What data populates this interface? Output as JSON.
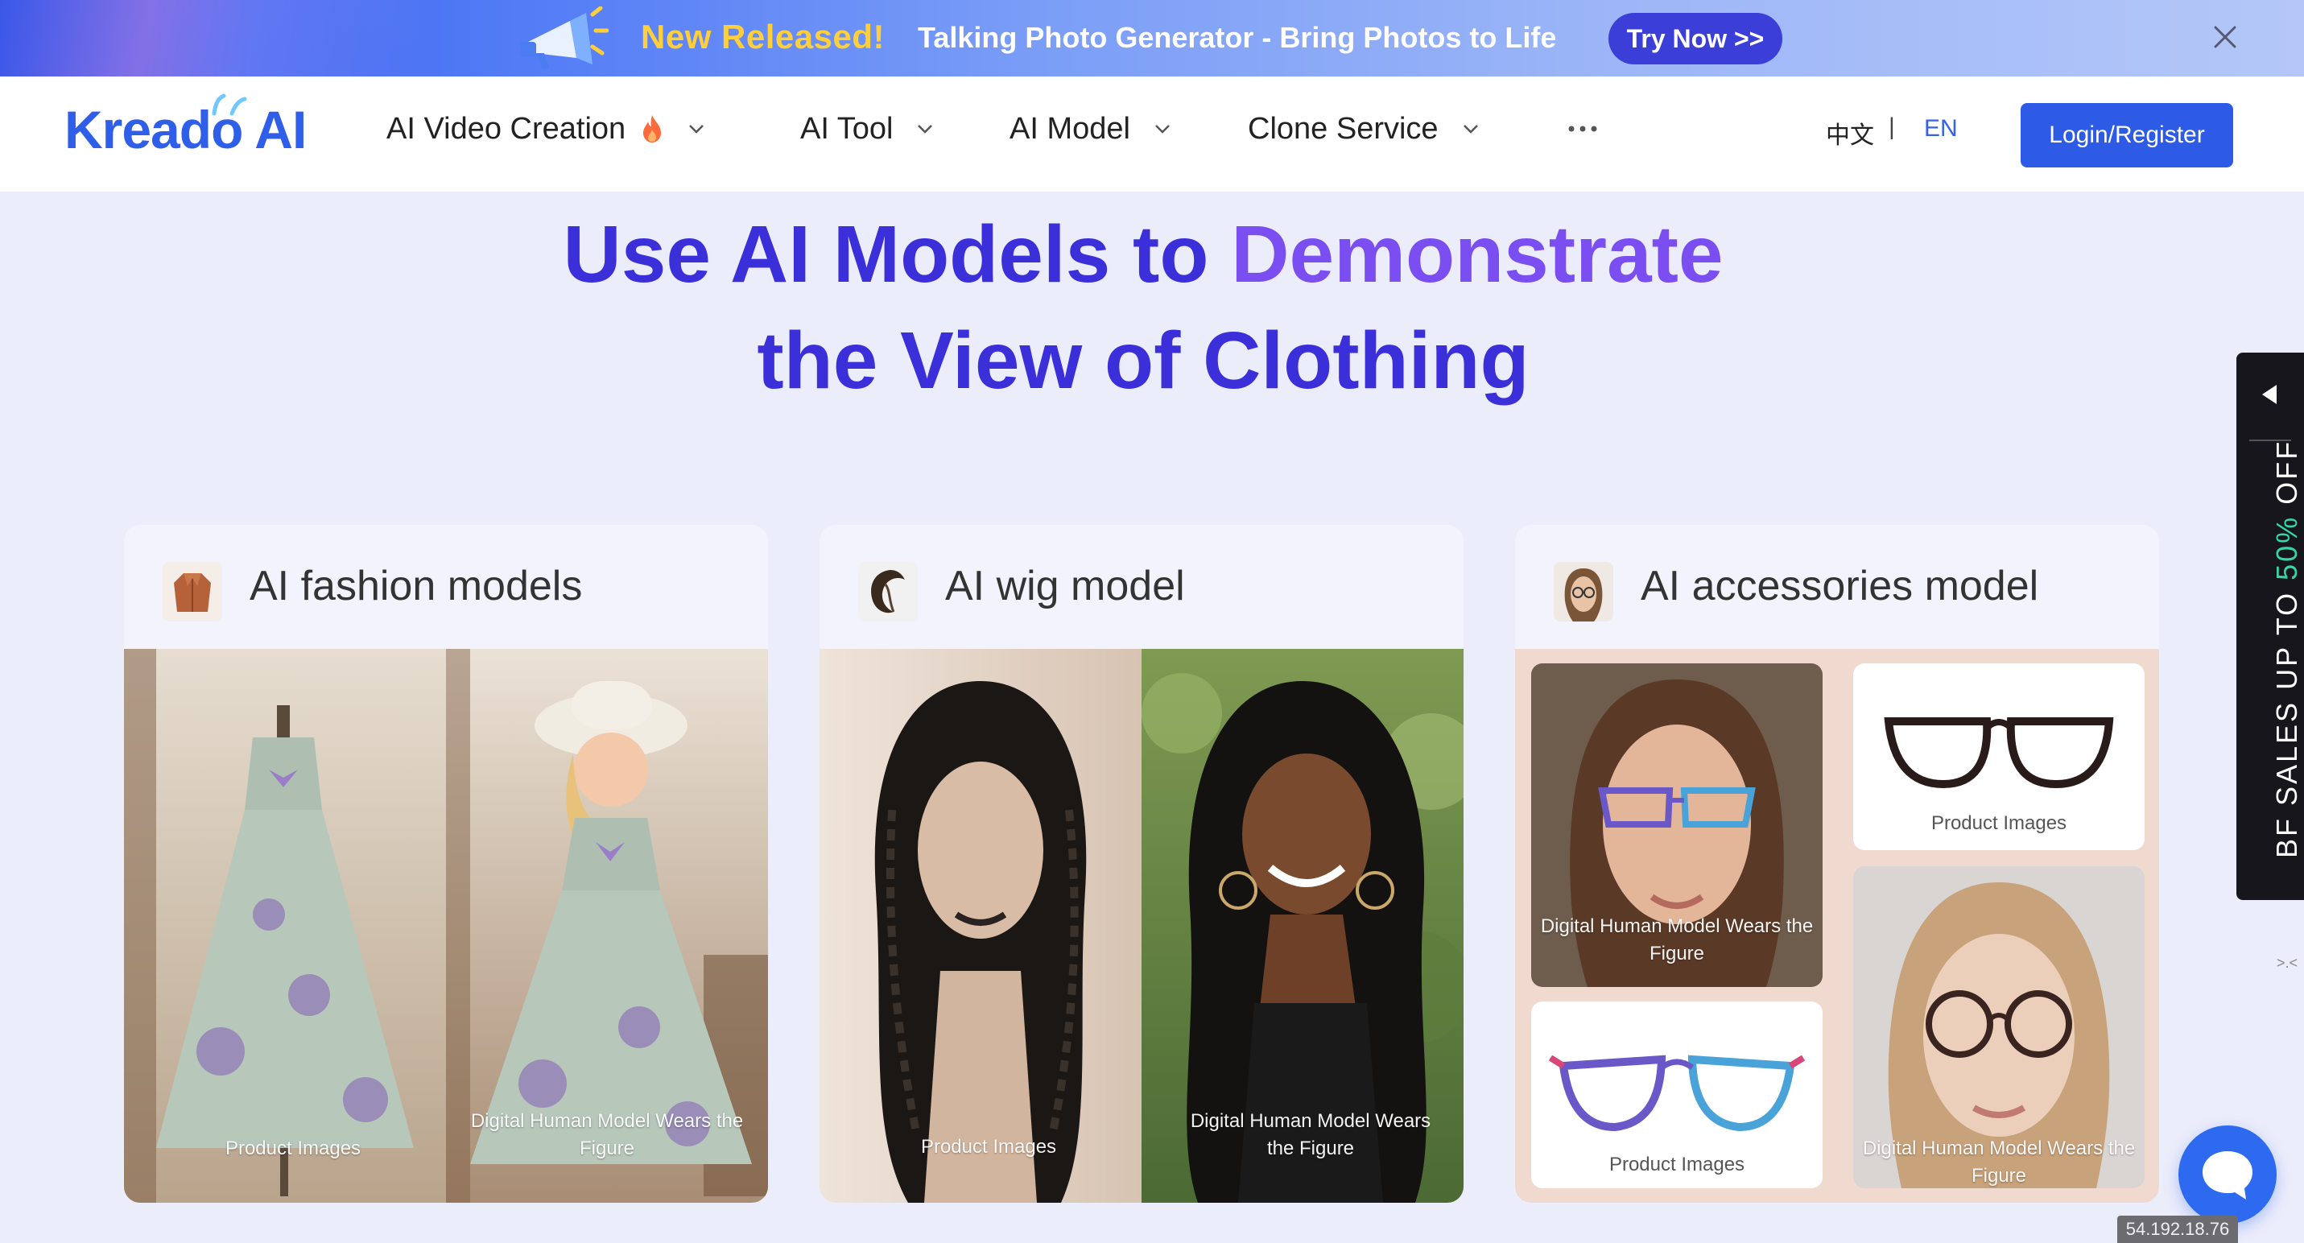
{
  "banner": {
    "new_label": "New Released!",
    "text": "Talking Photo Generator - Bring Photos to Life",
    "cta": "Try Now >>",
    "accent": "#ffcf3a",
    "close_icon": "close-icon"
  },
  "nav": {
    "logo": "Kreado AI",
    "items": [
      {
        "label": "AI Video Creation",
        "icon": "fire-icon"
      },
      {
        "label": "AI Tool"
      },
      {
        "label": "AI Model"
      },
      {
        "label": "Clone Service"
      }
    ],
    "more_icon": "more-dots-icon",
    "lang_zh": "中文",
    "lang_sep": "|",
    "lang_en": "EN",
    "login": "Login/Register",
    "brand_color": "#2d5be6"
  },
  "hero": {
    "line1_a": "Use AI Models to ",
    "line1_b": "Demonstrate",
    "line2": "the View of Clothing"
  },
  "cards": [
    {
      "title": "AI fashion models",
      "icon": "jacket-icon",
      "labels": [
        "Product Images",
        "Digital Human Model Wears the Figure"
      ]
    },
    {
      "title": "AI wig model",
      "icon": "wig-icon",
      "labels": [
        "Product Images",
        "Digital Human Model Wears the Figure"
      ]
    },
    {
      "title": "AI accessories model",
      "icon": "glasses-model-icon",
      "labels": [
        "Digital Human Model Wears the Figure",
        "Product Images",
        "Product Images",
        "Digital Human Model Wears the Figure"
      ]
    }
  ],
  "side_promo": {
    "prefix": "BF SALES UP TO ",
    "percent": "50%",
    "suffix": " OFF",
    "small": ">.<"
  },
  "ip_badge": "54.192.18.76"
}
